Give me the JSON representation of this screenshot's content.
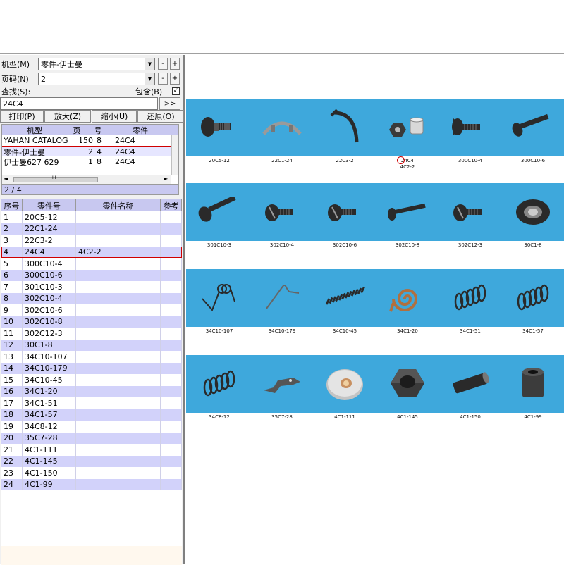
{
  "form": {
    "model_label": "机型(M)",
    "model_value": "零件-伊士曼",
    "page_label": "页码(N)",
    "page_value": "2",
    "search_label": "查找(S):",
    "include_label": "包含(B)",
    "include_checked": "✓",
    "search_value": "24C4",
    "go_label": ">>",
    "minus": "-",
    "plus": "+"
  },
  "toolbar": {
    "print": "打印(P)",
    "zoom_in": "放大(Z)",
    "zoom_out": "缩小(U)",
    "restore": "还原(O)"
  },
  "catalog_grid": {
    "headers": [
      "机型",
      "页",
      "号",
      "零件"
    ],
    "rows": [
      [
        "YAHAN CATALOG",
        "150",
        "8",
        "24C4"
      ],
      [
        "零件-伊士曼",
        "2",
        "4",
        "24C4"
      ],
      [
        "伊士曼627 629",
        "1",
        "8",
        "24C4"
      ]
    ],
    "scroll_arrow_left": "◄",
    "scroll_arrow_right": "►",
    "scroll_grip": "III",
    "pager": "2 / 4"
  },
  "parts_grid": {
    "headers": [
      "序号",
      "零件号",
      "零件名称",
      "参考"
    ],
    "rows": [
      [
        "1",
        "20C5-12",
        ""
      ],
      [
        "2",
        "22C1-24",
        ""
      ],
      [
        "3",
        "22C3-2",
        ""
      ],
      [
        "4",
        "24C4",
        "4C2-2"
      ],
      [
        "5",
        "300C10-4",
        ""
      ],
      [
        "6",
        "300C10-6",
        ""
      ],
      [
        "7",
        "301C10-3",
        ""
      ],
      [
        "8",
        "302C10-4",
        ""
      ],
      [
        "9",
        "302C10-6",
        ""
      ],
      [
        "10",
        "302C10-8",
        ""
      ],
      [
        "11",
        "302C12-3",
        ""
      ],
      [
        "12",
        "30C1-8",
        ""
      ],
      [
        "13",
        "34C10-107",
        ""
      ],
      [
        "14",
        "34C10-179",
        ""
      ],
      [
        "15",
        "34C10-45",
        ""
      ],
      [
        "16",
        "34C1-20",
        ""
      ],
      [
        "17",
        "34C1-51",
        ""
      ],
      [
        "18",
        "34C1-57",
        ""
      ],
      [
        "19",
        "34C8-12",
        ""
      ],
      [
        "20",
        "35C7-28",
        ""
      ],
      [
        "21",
        "4C1-111",
        ""
      ],
      [
        "22",
        "4C1-145",
        ""
      ],
      [
        "23",
        "4C1-150",
        ""
      ],
      [
        "24",
        "4C1-99",
        ""
      ]
    ],
    "selected_index": 3
  },
  "catalog_page": {
    "bands": [
      [
        {
          "label": "20C5-12",
          "icon": "thumb-screw-icon"
        },
        {
          "label": "22C1-24",
          "icon": "bracket-clip-icon"
        },
        {
          "label": "22C3-2",
          "icon": "curved-spring-icon"
        },
        {
          "label": "24C4",
          "label2": "4C2-2",
          "icon": "nut-and-cap-icon",
          "marked": true
        },
        {
          "label": "300C10-4",
          "icon": "round-screw-icon"
        },
        {
          "label": "300C10-6",
          "icon": "long-screw-icon"
        }
      ],
      [
        {
          "label": "301C10-3",
          "icon": "pan-screw-icon"
        },
        {
          "label": "302C10-4",
          "icon": "slotted-screw-icon"
        },
        {
          "label": "302C10-6",
          "icon": "slotted-screw-icon"
        },
        {
          "label": "302C10-8",
          "icon": "long-slotted-screw-icon"
        },
        {
          "label": "302C12-3",
          "icon": "slotted-screw-icon"
        },
        {
          "label": "30C1-8",
          "icon": "cap-plate-icon"
        }
      ],
      [
        {
          "label": "34C10-107",
          "icon": "torsion-spring-icon"
        },
        {
          "label": "34C10-179",
          "icon": "wire-spring-icon"
        },
        {
          "label": "34C10-45",
          "icon": "long-coil-spring-icon"
        },
        {
          "label": "34C1-20",
          "icon": "spiral-spring-icon"
        },
        {
          "label": "34C1-51",
          "icon": "coil-spring-icon"
        },
        {
          "label": "34C1-57",
          "icon": "coil-spring-icon"
        }
      ],
      [
        {
          "label": "34C8-12",
          "icon": "coil-spring-icon"
        },
        {
          "label": "35C7-28",
          "icon": "lever-icon"
        },
        {
          "label": "4C1-111",
          "icon": "collar-ring-icon"
        },
        {
          "label": "4C1-145",
          "icon": "hex-nut-icon"
        },
        {
          "label": "4C1-150",
          "icon": "pin-icon"
        },
        {
          "label": "4C1-99",
          "icon": "sleeve-icon"
        }
      ]
    ]
  },
  "colors": {
    "band_blue": "#3ea8dc",
    "grid_stripe": "#d2d2fa",
    "grid_header": "#c8c8f0",
    "selection_red": "#d00000"
  }
}
